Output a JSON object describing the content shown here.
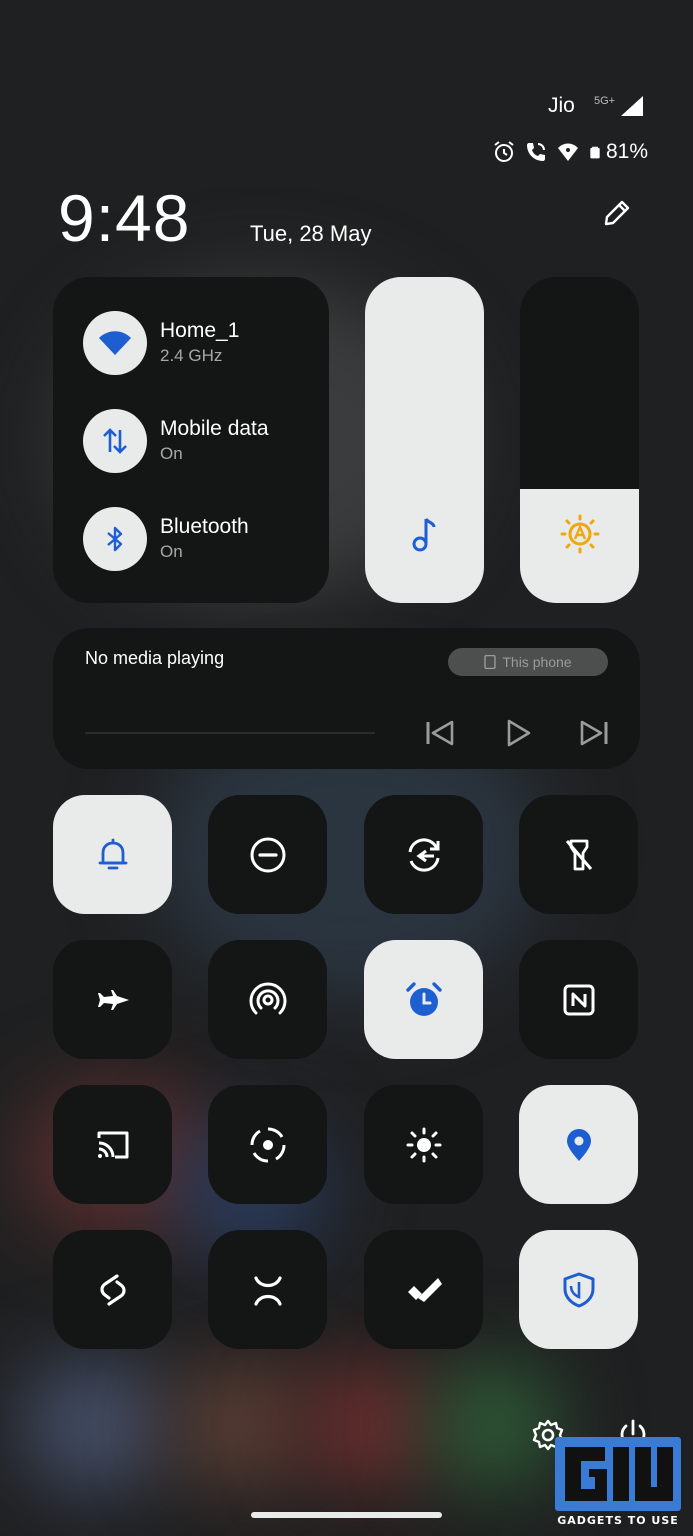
{
  "status": {
    "carrier": "Jio",
    "network_type": "5G+",
    "battery_percent": "81%",
    "icons": [
      "alarm-icon",
      "wifi-calling-icon",
      "hotspot-icon",
      "battery-icon"
    ]
  },
  "header": {
    "time": "9:48",
    "date": "Tue, 28 May",
    "edit_icon": "pencil-icon"
  },
  "connectivity": {
    "wifi": {
      "title": "Home_1",
      "subtitle": "2.4 GHz",
      "icon": "wifi-icon",
      "state": "on"
    },
    "mobile_data": {
      "title": "Mobile data",
      "subtitle": "On",
      "icon": "data-arrows-icon",
      "state": "on"
    },
    "bluetooth": {
      "title": "Bluetooth",
      "subtitle": "On",
      "icon": "bluetooth-icon",
      "state": "on"
    }
  },
  "sliders": {
    "volume": {
      "icon": "music-note-icon",
      "level": 1.0
    },
    "brightness": {
      "icon": "auto-brightness-icon",
      "level": 0.35
    }
  },
  "media": {
    "status": "No media playing",
    "output": "This phone",
    "controls": [
      "previous-icon",
      "play-icon",
      "next-icon"
    ]
  },
  "tiles": [
    {
      "name": "tile-sound",
      "icon": "bell-icon",
      "state": "on"
    },
    {
      "name": "tile-dnd",
      "icon": "do-not-disturb-icon",
      "state": "off"
    },
    {
      "name": "tile-auto-rotate",
      "icon": "rotate-icon",
      "state": "off"
    },
    {
      "name": "tile-flashlight",
      "icon": "flashlight-off-icon",
      "state": "off"
    },
    {
      "name": "tile-airplane",
      "icon": "airplane-icon",
      "state": "off"
    },
    {
      "name": "tile-hotspot",
      "icon": "hotspot-icon",
      "state": "off"
    },
    {
      "name": "tile-alarm",
      "icon": "alarm-clock-icon",
      "state": "on"
    },
    {
      "name": "tile-nfc",
      "icon": "nfc-icon",
      "state": "off"
    },
    {
      "name": "tile-cast",
      "icon": "cast-icon",
      "state": "off"
    },
    {
      "name": "tile-screen-record",
      "icon": "screen-record-icon",
      "state": "off"
    },
    {
      "name": "tile-brightness",
      "icon": "sun-icon",
      "state": "off"
    },
    {
      "name": "tile-location",
      "icon": "location-pin-icon",
      "state": "on"
    },
    {
      "name": "tile-link",
      "icon": "link-icon",
      "state": "off"
    },
    {
      "name": "tile-face",
      "icon": "face-icon",
      "state": "off"
    },
    {
      "name": "tile-check",
      "icon": "double-check-icon",
      "state": "off"
    },
    {
      "name": "tile-shield",
      "icon": "shield-icon",
      "state": "on"
    }
  ],
  "footer": {
    "settings_icon": "settings-gear-icon",
    "power_icon": "power-icon"
  },
  "watermark": {
    "text": "GADGETS TO USE"
  },
  "colors": {
    "accent_blue": "#1d5fd1",
    "accent_yellow": "#f0a70a",
    "tile_on": "#e9eaea",
    "tile_off": "#141515"
  }
}
